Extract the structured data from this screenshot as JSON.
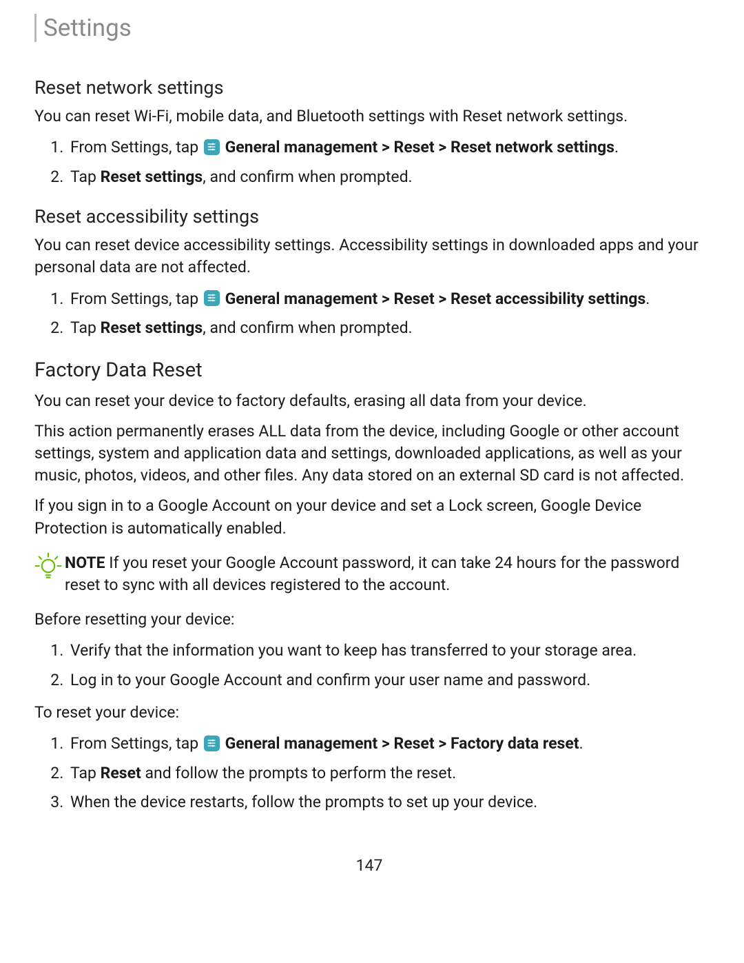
{
  "header": "Settings",
  "section1": {
    "heading": "Reset network settings",
    "intro": "You can reset Wi-Fi, mobile data, and Bluetooth settings with Reset network settings.",
    "steps": {
      "s1_prefix": "From Settings, tap ",
      "s1_bold": "General management > Reset > Reset network settings",
      "s1_period": ".",
      "s2_prefix": "Tap ",
      "s2_bold": "Reset settings",
      "s2_suffix": ", and confirm when prompted."
    }
  },
  "section2": {
    "heading": "Reset accessibility settings",
    "intro": "You can reset device accessibility settings. Accessibility settings in downloaded apps and your personal data are not affected.",
    "steps": {
      "s1_prefix": "From Settings, tap ",
      "s1_bold": "General management > Reset > Reset accessibility settings",
      "s1_period": ".",
      "s2_prefix": "Tap ",
      "s2_bold": "Reset settings",
      "s2_suffix": ", and confirm when prompted."
    }
  },
  "section3": {
    "heading": "Factory Data Reset",
    "intro1": "You can reset your device to factory defaults, erasing all data from your device.",
    "intro2": "This action permanently erases ALL data from the device, including Google or other account settings, system and application data and settings, downloaded applications, as well as your music, photos, videos, and other files. Any data stored on an external SD card is not affected.",
    "intro3": "If you sign in to a Google Account on your device and set a Lock screen, Google Device Protection is automatically enabled.",
    "note_label": "NOTE",
    "note_text": "  If you reset your Google Account password, it can take 24 hours for the password reset to sync with all devices registered to the account.",
    "before_heading": "Before resetting your device:",
    "before_steps": {
      "s1": "Verify that the information you want to keep has transferred to your storage area.",
      "s2": "Log in to your Google Account and confirm your user name and password."
    },
    "toreset_heading": "To reset your device:",
    "reset_steps": {
      "s1_prefix": "From Settings, tap ",
      "s1_bold": "General management > Reset > Factory data reset",
      "s1_period": ".",
      "s2_prefix": "Tap ",
      "s2_bold": "Reset",
      "s2_suffix": " and follow the prompts to perform the reset.",
      "s3": "When the device restarts, follow the prompts to set up your device."
    }
  },
  "page_number": "147"
}
